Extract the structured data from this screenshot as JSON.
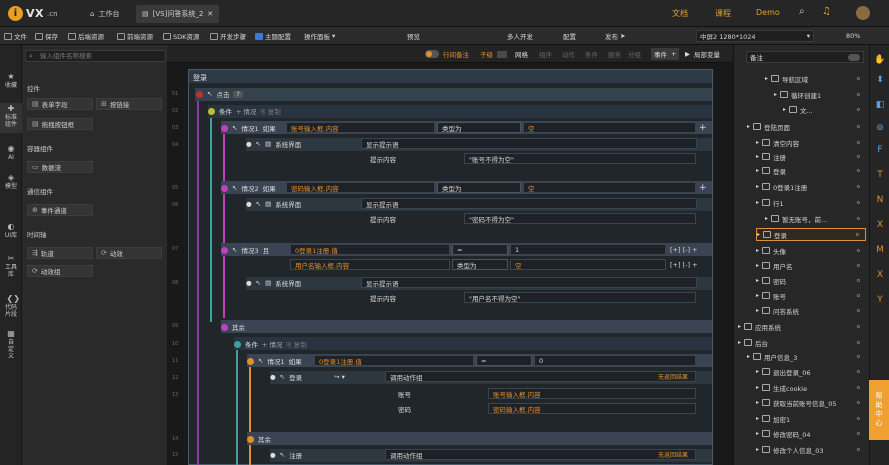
{
  "topbar": {
    "logo_text": "VX",
    "logo_suffix": ".cn",
    "tabs": [
      {
        "label": "工作台",
        "icon": "home-icon"
      },
      {
        "label": "[VS]问答系统_2",
        "icon": "page-icon",
        "active": true
      }
    ],
    "links": [
      "文档",
      "课程",
      "Demo"
    ],
    "accent": "#e09030"
  },
  "toolbar": {
    "left": [
      "文件",
      "保存",
      "后端资源",
      "前端资源",
      "SDK资源",
      "开发步骤",
      "主题配置",
      "操作面板"
    ],
    "mode_buttons": [
      "预览",
      "多人开发",
      "配置",
      "发布"
    ],
    "resolution": "中屏2 1280*1024",
    "zoom": "80%"
  },
  "leftnav": [
    "收藏",
    "标准组件",
    "AI",
    "模型",
    "UI库",
    "工具库",
    "代码片段",
    "自定义"
  ],
  "leftpanel": {
    "search_placeholder": "输入组件名称搜索",
    "categories": [
      {
        "title": "控件",
        "items": [
          "表单字段",
          "按链接",
          "拖拽按钮框"
        ]
      },
      {
        "title": "容器组件",
        "items": [
          "数据流"
        ]
      },
      {
        "title": "通信组件",
        "items": [
          "事件通道"
        ]
      },
      {
        "title": "时间轴",
        "items": [
          "轨道",
          "动效",
          "动效组"
        ]
      }
    ]
  },
  "canvasbar": {
    "items": [
      "行间备注",
      "子级",
      "网格",
      "组件",
      "动作",
      "条件",
      "服务",
      "分组"
    ],
    "right": [
      "事件",
      "局部变量"
    ]
  },
  "logic": {
    "title": "登录",
    "event": "点击",
    "cond": "条件",
    "add_case": "情况",
    "copy": "复制",
    "cases": [
      {
        "label": "情况1",
        "kw": "如果",
        "field": "账号输入框.内容",
        "op": "类型为",
        "val": "空",
        "action": "系统界面",
        "action_type": "显示提示语",
        "prop": "提示内容",
        "content": "\"账号不得为空\""
      },
      {
        "label": "情况2",
        "kw": "如果",
        "field": "密码输入框.内容",
        "op": "类型为",
        "val": "空",
        "action": "系统界面",
        "action_type": "显示提示语",
        "prop": "提示内容",
        "content": "\"密码不得为空\""
      },
      {
        "label": "情况3",
        "kw": "且",
        "field": "0登录1注册.值",
        "op": "=",
        "val": "1",
        "field2": "用户名输入框.内容",
        "op2": "类型为",
        "val2": "空",
        "action": "系统界面",
        "action_type": "显示提示语",
        "prop": "提示内容",
        "content": "\"用户名不得为空\""
      }
    ],
    "else_label": "其余",
    "nested": {
      "cond": "条件",
      "case": "情况1",
      "kw": "如果",
      "field": "0登录1注册.值",
      "op": "=",
      "val": "0",
      "action": "登录",
      "action_type": "调用动作组",
      "return_label": "无返回结果",
      "params": [
        {
          "name": "账号",
          "value": "账号输入框.内容"
        },
        {
          "name": "密码",
          "value": "密码输入框.内容"
        }
      ],
      "else_label": "其余",
      "else_action": "注册",
      "else_action_type": "调用动作组",
      "else_return": "无返回结果"
    },
    "line_numbers": [
      "01",
      "02",
      "03",
      "04",
      "05",
      "06",
      "07",
      "08",
      "09",
      "10",
      "11",
      "12",
      "13",
      "14",
      "15"
    ]
  },
  "rightpanel": {
    "header": "备注",
    "tree": [
      {
        "label": "导航区域",
        "depth": 3
      },
      {
        "label": "循环创建1",
        "depth": 4
      },
      {
        "label": "文...",
        "depth": 5
      },
      {
        "label": "登陆页面",
        "depth": 1
      },
      {
        "label": "清空内容",
        "depth": 2
      },
      {
        "label": "注册",
        "depth": 2
      },
      {
        "label": "登录",
        "depth": 2
      },
      {
        "label": "0登录1注册",
        "depth": 2
      },
      {
        "label": "行1",
        "depth": 2
      },
      {
        "label": "暂无账号，前...",
        "depth": 3
      },
      {
        "label": "登录",
        "depth": 2,
        "highlight": true
      },
      {
        "label": "头像",
        "depth": 2
      },
      {
        "label": "用户名",
        "depth": 2
      },
      {
        "label": "密码",
        "depth": 2
      },
      {
        "label": "账号",
        "depth": 2
      },
      {
        "label": "问答系统",
        "depth": 2
      },
      {
        "label": "应用系统",
        "depth": 0
      },
      {
        "label": "后台",
        "depth": 0
      },
      {
        "label": "用户信息_3",
        "depth": 1
      },
      {
        "label": "退出登录_06",
        "depth": 2
      },
      {
        "label": "生成cookie",
        "depth": 2
      },
      {
        "label": "获取当前账号信息_05",
        "depth": 2
      },
      {
        "label": "加密1",
        "depth": 2
      },
      {
        "label": "修改密码_04",
        "depth": 2
      },
      {
        "label": "修改个人信息_03",
        "depth": 2
      }
    ]
  },
  "rightbar": {
    "icons": [
      "F",
      "T",
      "N",
      "X",
      "M",
      "X",
      "Y"
    ],
    "help": "帮助中心"
  }
}
